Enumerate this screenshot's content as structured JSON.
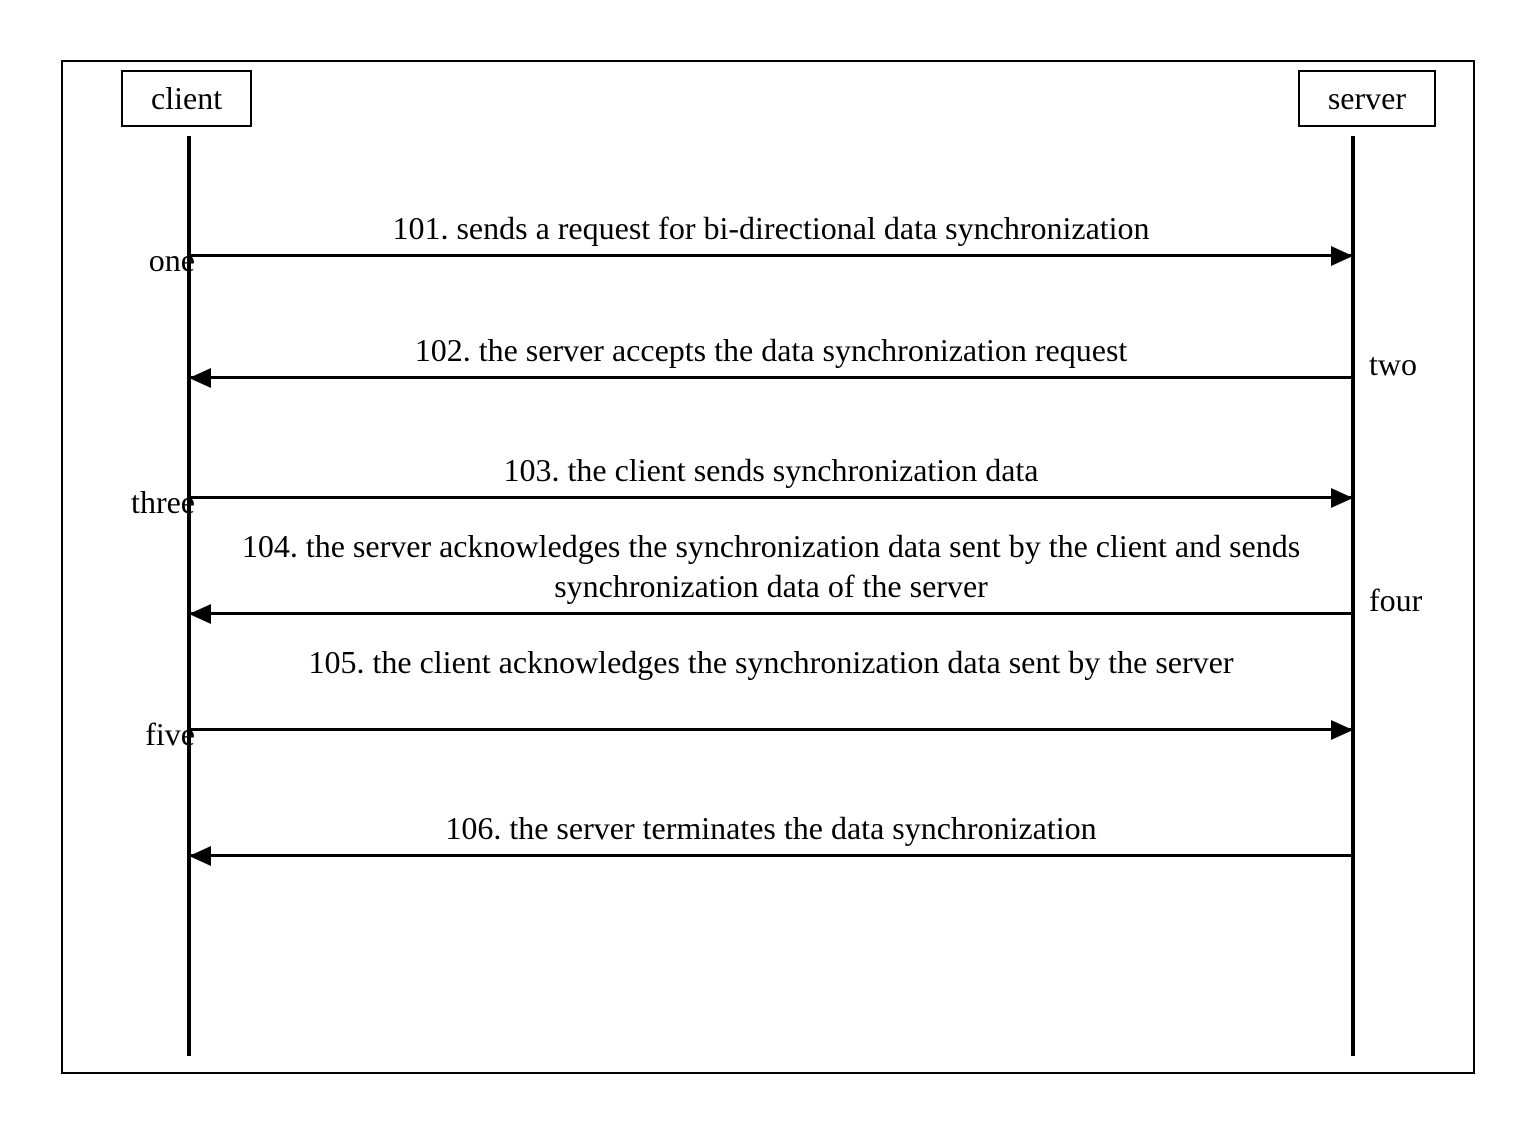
{
  "actors": {
    "client": "client",
    "server": "server"
  },
  "phases": {
    "one": "one",
    "two": "two",
    "three": "three",
    "four": "four",
    "five": "five"
  },
  "messages": {
    "m101": "101. sends a request for bi-directional data synchronization",
    "m102": "102. the server accepts the data synchronization request",
    "m103": "103. the client sends synchronization data",
    "m104": "104. the server acknowledges the synchronization data sent by the client and sends synchronization data of the server",
    "m105": "105. the client  acknowledges the synchronization data sent by the server",
    "m106": "106. the server terminates the data synchronization"
  }
}
